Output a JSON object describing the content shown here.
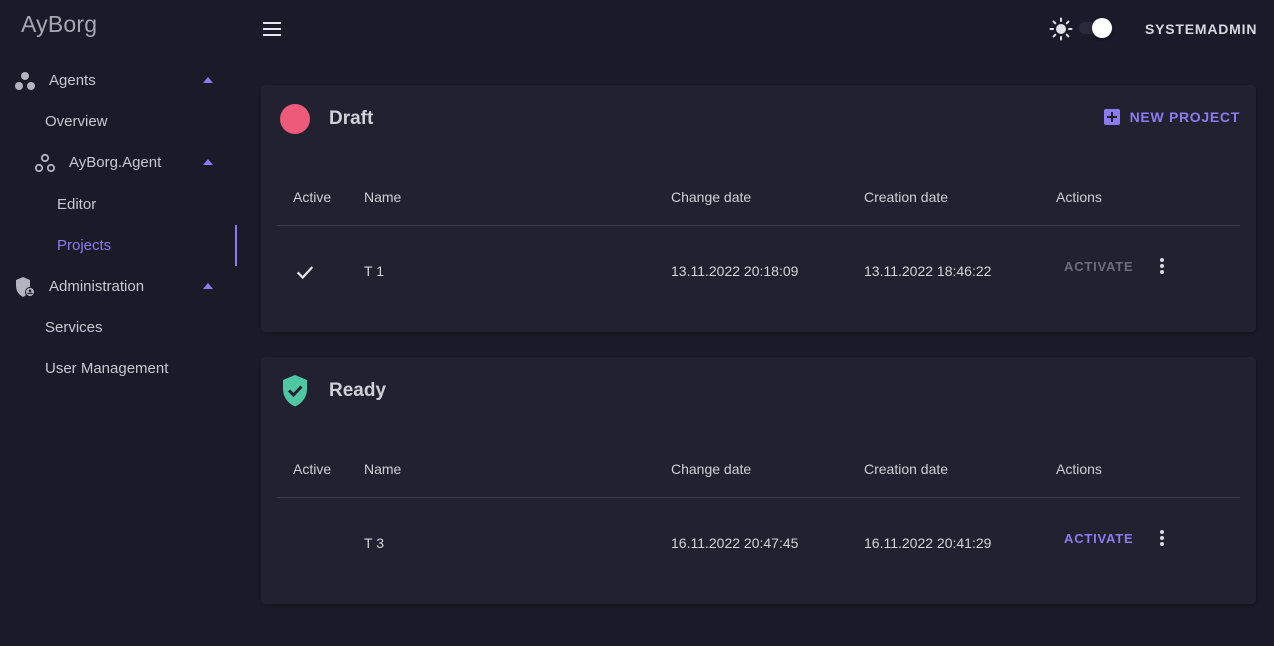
{
  "brand": "AyBorg",
  "sidebar": {
    "items": [
      {
        "label": "Agents",
        "icon": "agents-icon"
      },
      {
        "label": "Overview"
      },
      {
        "label": "AyBorg.Agent",
        "icon": "agent-icon"
      },
      {
        "label": "Editor"
      },
      {
        "label": "Projects"
      },
      {
        "label": "Administration",
        "icon": "admin-shield-icon"
      },
      {
        "label": "Services"
      },
      {
        "label": "User Management"
      }
    ]
  },
  "topbar": {
    "user": "SYSTEMADMIN"
  },
  "draft": {
    "title": "Draft",
    "new_project": "NEW PROJECT",
    "headers": {
      "active": "Active",
      "name": "Name",
      "change": "Change date",
      "creation": "Creation date",
      "actions": "Actions"
    },
    "rows": [
      {
        "active": true,
        "name": "T 1",
        "change": "13.11.2022 20:18:09",
        "creation": "13.11.2022 18:46:22",
        "action": "ACTIVATE",
        "action_enabled": false
      }
    ]
  },
  "ready": {
    "title": "Ready",
    "headers": {
      "active": "Active",
      "name": "Name",
      "change": "Change date",
      "creation": "Creation date",
      "actions": "Actions"
    },
    "rows": [
      {
        "active": false,
        "name": "T 3",
        "change": "16.11.2022 20:47:45",
        "creation": "16.11.2022 20:41:29",
        "action": "ACTIVATE",
        "action_enabled": true
      }
    ]
  },
  "colors": {
    "background": "#1b1a28",
    "card": "#22212f",
    "accent": "#8a7cf0",
    "draft_status": "#ee5a7a",
    "ready_status": "#4fc6a4"
  }
}
